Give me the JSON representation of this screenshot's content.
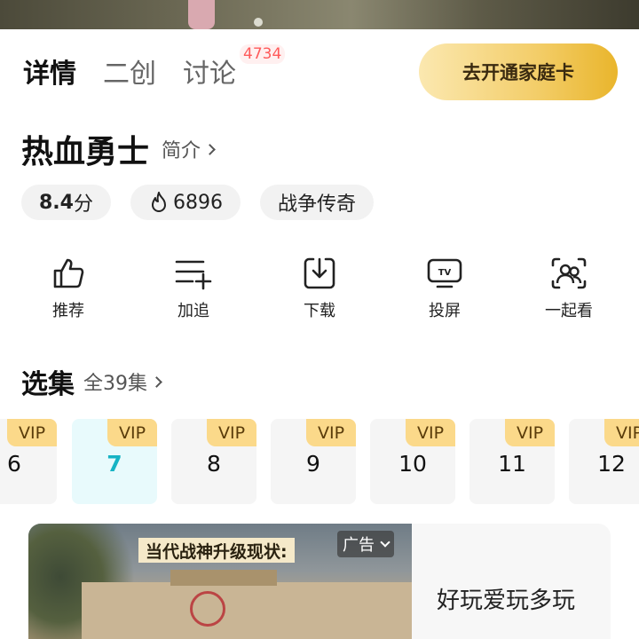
{
  "tabs": [
    {
      "label": "详情",
      "active": true
    },
    {
      "label": "二创",
      "active": false
    },
    {
      "label": "讨论",
      "active": false,
      "badge": "4734"
    }
  ],
  "family_card_button": "去开通家庭卡",
  "show": {
    "title": "热血勇士",
    "intro_label": "简介"
  },
  "tags": {
    "score_value": "8.4",
    "score_unit": "分",
    "heat": "6896",
    "genre": "战争传奇"
  },
  "actions": [
    {
      "label": "推荐",
      "icon": "thumbs-up-icon"
    },
    {
      "label": "加追",
      "icon": "add-to-list-icon"
    },
    {
      "label": "下载",
      "icon": "download-icon"
    },
    {
      "label": "投屏",
      "icon": "tv-cast-icon"
    },
    {
      "label": "一起看",
      "icon": "watch-together-icon"
    }
  ],
  "episodes": {
    "title": "选集",
    "count_label": "全39集",
    "vip_label": "VIP",
    "selected": "7",
    "items": [
      "6",
      "7",
      "8",
      "9",
      "10",
      "11",
      "12"
    ]
  },
  "ad": {
    "caption": "当代战神升级现状:",
    "badge": "广告",
    "text": "好玩爱玩多玩"
  },
  "colors": {
    "accent": "#16b3c4",
    "vip": "#fbd98a",
    "badge": "#ff5a5a"
  }
}
